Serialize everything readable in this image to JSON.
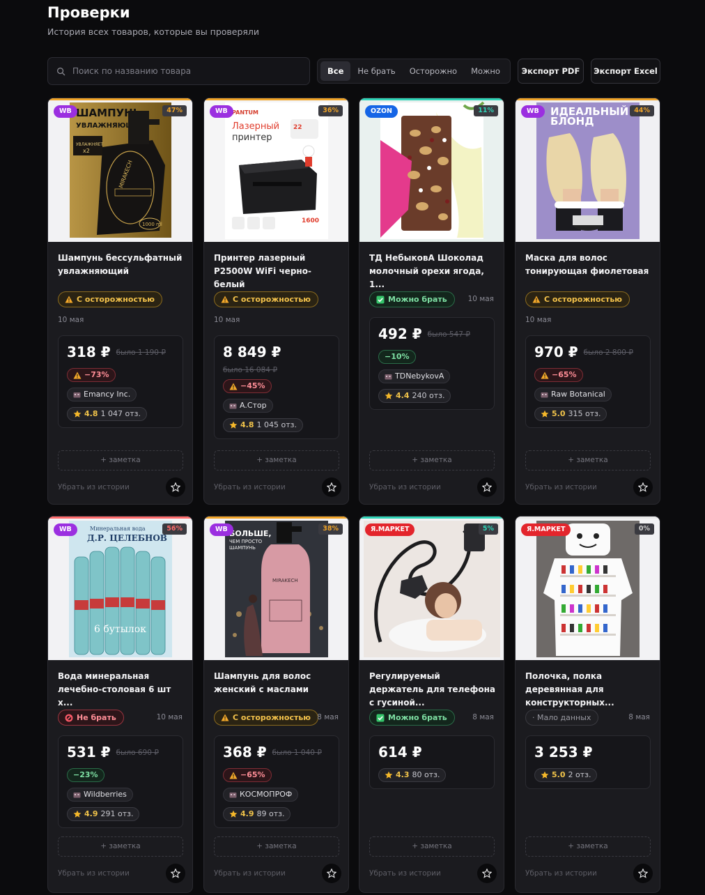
{
  "header": {
    "title": "Проверки",
    "subtitle": "История всех товаров, которые вы проверяли"
  },
  "search": {
    "placeholder": "Поиск по названию товара",
    "value": ""
  },
  "filters": [
    {
      "label": "Все",
      "active": true
    },
    {
      "label": "Не брать",
      "active": false
    },
    {
      "label": "Осторожно",
      "active": false
    },
    {
      "label": "Можно",
      "active": false
    }
  ],
  "export": {
    "pdf_label": "Экспорт PDF",
    "excel_label": "Экспорт Excel"
  },
  "card_common": {
    "note_label": "+ заметка",
    "remove_label": "Убрать из истории"
  },
  "colors": {
    "caution": "#f3c24b",
    "ok": "#7ee0a3",
    "no": "#ff8e97",
    "wb": "#9b2fe0",
    "ozon": "#1565e6",
    "ymarket": "#e3252c"
  },
  "cards": [
    {
      "marketplace": "WB",
      "mp_class": "wb",
      "percent": "47%",
      "pct_class": "orange",
      "name": "Шампунь бессульфатный увлажняющий",
      "status": "С осторожностью",
      "status_class": "caution",
      "status_icon": "warning-icon",
      "date": "10 мая",
      "price": "318 ₽",
      "old_price": "было 1 190 ₽",
      "discount": "−73%",
      "discount_class": "disc-red",
      "seller": "Emancy Inc.",
      "rating": "4.8",
      "reviews": "1 047 отз.",
      "image": "shampoo-gold-bottle"
    },
    {
      "marketplace": "WB",
      "mp_class": "wb",
      "percent": "36%",
      "pct_class": "orange",
      "name": "Принтер лазерный P2500W WiFi черно-белый",
      "status": "С осторожностью",
      "status_class": "caution",
      "status_icon": "warning-icon",
      "date": "10 мая",
      "price": "8 849 ₽",
      "old_price": "было 16 084 ₽",
      "discount": "−45%",
      "discount_class": "disc-red",
      "seller": "A.Стор",
      "rating": "4.8",
      "reviews": "1 045 отз.",
      "image": "laser-printer",
      "image_text": {
        "brand": "PANTUM",
        "line1": "Лазерный",
        "line2": "принтер",
        "pages": "22",
        "count": "1600"
      }
    },
    {
      "marketplace": "OZON",
      "mp_class": "ozon",
      "percent": "11%",
      "pct_class": "teal",
      "name": "ТД НебыковА Шоколад молочный орехи ягода, 1...",
      "status": "Можно брать",
      "status_class": "ok",
      "status_icon": "check-icon",
      "date": "10 мая",
      "price": "492 ₽",
      "old_price": "было 547 ₽",
      "discount": "−10%",
      "discount_class": "disc-green",
      "seller": "TDNebykovA",
      "rating": "4.4",
      "reviews": "240 отз.",
      "image": "chocolate-bar"
    },
    {
      "marketplace": "WB",
      "mp_class": "wb",
      "percent": "44%",
      "pct_class": "orange",
      "name": "Маска для волос тонирующая фиолетовая",
      "status": "С осторожностью",
      "status_class": "caution",
      "status_icon": "warning-icon",
      "date": "10 мая",
      "price": "970 ₽",
      "old_price": "было 2 800 ₽",
      "discount": "−65%",
      "discount_class": "disc-red",
      "seller": "Raw Botanical",
      "rating": "5.0",
      "reviews": "315 отз.",
      "image": "hair-mask-blonde",
      "image_text": {
        "line1": "ИДЕАЛЬНЫЙ",
        "line2": "БЛОНД"
      }
    },
    {
      "marketplace": "WB",
      "mp_class": "wb",
      "percent": "56%",
      "pct_class": "red",
      "name": "Вода минеральная лечебно-столовая 6 шт х...",
      "status": "Не брать",
      "status_class": "no",
      "status_icon": "ban-icon",
      "date": "10 мая",
      "price": "531 ₽",
      "old_price": "было 690 ₽",
      "discount": "−23%",
      "discount_class": "disc-green",
      "seller": "Wildberries",
      "rating": "4.9",
      "reviews": "291 отз.",
      "image": "mineral-water-bottles",
      "image_text": {
        "line1": "Минеральная вода",
        "line2": "Д.Р. ЦЕЛЕБНОВ",
        "line3": "6 бутылок"
      }
    },
    {
      "marketplace": "WB",
      "mp_class": "wb",
      "percent": "38%",
      "pct_class": "orange",
      "name": "Шампунь для волос женский с маслами",
      "status": "С осторожностью",
      "status_class": "caution",
      "status_icon": "warning-icon",
      "date": "8 мая",
      "price": "368 ₽",
      "old_price": "было 1 040 ₽",
      "discount": "−65%",
      "discount_class": "disc-red",
      "seller": "КОСМОПРОФ",
      "rating": "4.9",
      "reviews": "89 отз.",
      "image": "pink-shampoo-bottle",
      "image_text": {
        "line1": "БОЛЬШЕ,",
        "line2": "ЧЕМ ПРОСТО",
        "line3": "ШАМПУНЬ"
      }
    },
    {
      "marketplace": "Я.МАРКЕТ",
      "mp_class": "ym",
      "percent": "5%",
      "pct_class": "teal",
      "name": "Регулируемый держатель для телефона с гусиной...",
      "status": "Можно брать",
      "status_class": "ok",
      "status_icon": "check-icon",
      "date": "8 мая",
      "price": "614 ₽",
      "rating": "4.3",
      "reviews": "80 отз.",
      "image": "gooseneck-phone-holder"
    },
    {
      "marketplace": "Я.МАРКЕТ",
      "mp_class": "ym",
      "percent": "0%",
      "pct_class": "gray",
      "name": "Полочка, полка деревянная для конструкторных...",
      "status": "· Мало данных",
      "status_class": "few",
      "status_icon": "",
      "date": "8 мая",
      "price": "3 253 ₽",
      "rating": "5.0",
      "reviews": "2 отз.",
      "image": "wooden-shelf-robot"
    }
  ]
}
